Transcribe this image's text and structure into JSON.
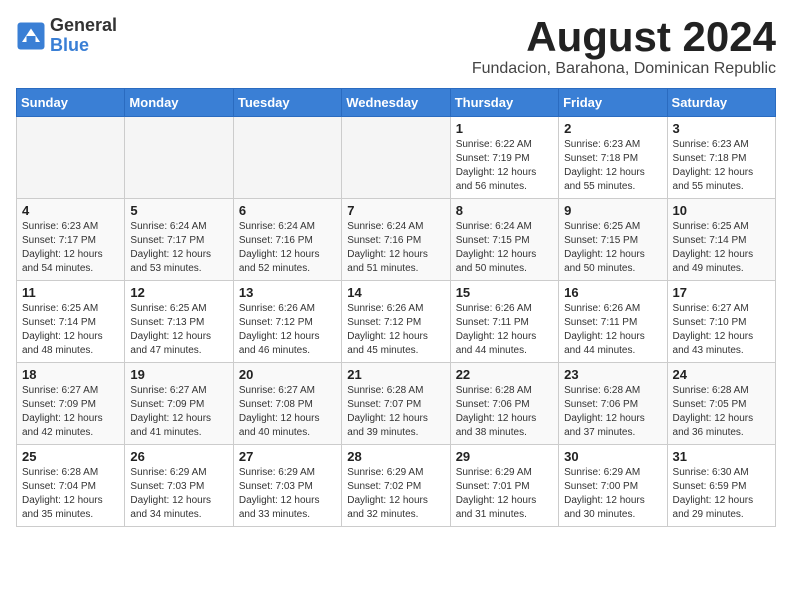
{
  "header": {
    "logo_general": "General",
    "logo_blue": "Blue",
    "month_year": "August 2024",
    "location": "Fundacion, Barahona, Dominican Republic"
  },
  "days_of_week": [
    "Sunday",
    "Monday",
    "Tuesday",
    "Wednesday",
    "Thursday",
    "Friday",
    "Saturday"
  ],
  "weeks": [
    [
      {
        "day": "",
        "info": ""
      },
      {
        "day": "",
        "info": ""
      },
      {
        "day": "",
        "info": ""
      },
      {
        "day": "",
        "info": ""
      },
      {
        "day": "1",
        "info": "Sunrise: 6:22 AM\nSunset: 7:19 PM\nDaylight: 12 hours\nand 56 minutes."
      },
      {
        "day": "2",
        "info": "Sunrise: 6:23 AM\nSunset: 7:18 PM\nDaylight: 12 hours\nand 55 minutes."
      },
      {
        "day": "3",
        "info": "Sunrise: 6:23 AM\nSunset: 7:18 PM\nDaylight: 12 hours\nand 55 minutes."
      }
    ],
    [
      {
        "day": "4",
        "info": "Sunrise: 6:23 AM\nSunset: 7:17 PM\nDaylight: 12 hours\nand 54 minutes."
      },
      {
        "day": "5",
        "info": "Sunrise: 6:24 AM\nSunset: 7:17 PM\nDaylight: 12 hours\nand 53 minutes."
      },
      {
        "day": "6",
        "info": "Sunrise: 6:24 AM\nSunset: 7:16 PM\nDaylight: 12 hours\nand 52 minutes."
      },
      {
        "day": "7",
        "info": "Sunrise: 6:24 AM\nSunset: 7:16 PM\nDaylight: 12 hours\nand 51 minutes."
      },
      {
        "day": "8",
        "info": "Sunrise: 6:24 AM\nSunset: 7:15 PM\nDaylight: 12 hours\nand 50 minutes."
      },
      {
        "day": "9",
        "info": "Sunrise: 6:25 AM\nSunset: 7:15 PM\nDaylight: 12 hours\nand 50 minutes."
      },
      {
        "day": "10",
        "info": "Sunrise: 6:25 AM\nSunset: 7:14 PM\nDaylight: 12 hours\nand 49 minutes."
      }
    ],
    [
      {
        "day": "11",
        "info": "Sunrise: 6:25 AM\nSunset: 7:14 PM\nDaylight: 12 hours\nand 48 minutes."
      },
      {
        "day": "12",
        "info": "Sunrise: 6:25 AM\nSunset: 7:13 PM\nDaylight: 12 hours\nand 47 minutes."
      },
      {
        "day": "13",
        "info": "Sunrise: 6:26 AM\nSunset: 7:12 PM\nDaylight: 12 hours\nand 46 minutes."
      },
      {
        "day": "14",
        "info": "Sunrise: 6:26 AM\nSunset: 7:12 PM\nDaylight: 12 hours\nand 45 minutes."
      },
      {
        "day": "15",
        "info": "Sunrise: 6:26 AM\nSunset: 7:11 PM\nDaylight: 12 hours\nand 44 minutes."
      },
      {
        "day": "16",
        "info": "Sunrise: 6:26 AM\nSunset: 7:11 PM\nDaylight: 12 hours\nand 44 minutes."
      },
      {
        "day": "17",
        "info": "Sunrise: 6:27 AM\nSunset: 7:10 PM\nDaylight: 12 hours\nand 43 minutes."
      }
    ],
    [
      {
        "day": "18",
        "info": "Sunrise: 6:27 AM\nSunset: 7:09 PM\nDaylight: 12 hours\nand 42 minutes."
      },
      {
        "day": "19",
        "info": "Sunrise: 6:27 AM\nSunset: 7:09 PM\nDaylight: 12 hours\nand 41 minutes."
      },
      {
        "day": "20",
        "info": "Sunrise: 6:27 AM\nSunset: 7:08 PM\nDaylight: 12 hours\nand 40 minutes."
      },
      {
        "day": "21",
        "info": "Sunrise: 6:28 AM\nSunset: 7:07 PM\nDaylight: 12 hours\nand 39 minutes."
      },
      {
        "day": "22",
        "info": "Sunrise: 6:28 AM\nSunset: 7:06 PM\nDaylight: 12 hours\nand 38 minutes."
      },
      {
        "day": "23",
        "info": "Sunrise: 6:28 AM\nSunset: 7:06 PM\nDaylight: 12 hours\nand 37 minutes."
      },
      {
        "day": "24",
        "info": "Sunrise: 6:28 AM\nSunset: 7:05 PM\nDaylight: 12 hours\nand 36 minutes."
      }
    ],
    [
      {
        "day": "25",
        "info": "Sunrise: 6:28 AM\nSunset: 7:04 PM\nDaylight: 12 hours\nand 35 minutes."
      },
      {
        "day": "26",
        "info": "Sunrise: 6:29 AM\nSunset: 7:03 PM\nDaylight: 12 hours\nand 34 minutes."
      },
      {
        "day": "27",
        "info": "Sunrise: 6:29 AM\nSunset: 7:03 PM\nDaylight: 12 hours\nand 33 minutes."
      },
      {
        "day": "28",
        "info": "Sunrise: 6:29 AM\nSunset: 7:02 PM\nDaylight: 12 hours\nand 32 minutes."
      },
      {
        "day": "29",
        "info": "Sunrise: 6:29 AM\nSunset: 7:01 PM\nDaylight: 12 hours\nand 31 minutes."
      },
      {
        "day": "30",
        "info": "Sunrise: 6:29 AM\nSunset: 7:00 PM\nDaylight: 12 hours\nand 30 minutes."
      },
      {
        "day": "31",
        "info": "Sunrise: 6:30 AM\nSunset: 6:59 PM\nDaylight: 12 hours\nand 29 minutes."
      }
    ]
  ]
}
